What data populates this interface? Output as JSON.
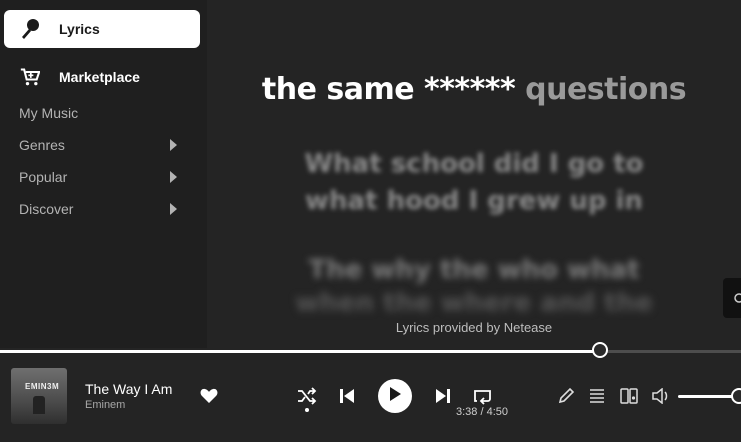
{
  "sidebar": {
    "lyrics_label": "Lyrics",
    "marketplace_label": "Marketplace",
    "items": [
      {
        "label": "My Music",
        "has_arrow": false
      },
      {
        "label": "Genres",
        "has_arrow": true
      },
      {
        "label": "Popular",
        "has_arrow": true
      },
      {
        "label": "Discover",
        "has_arrow": true
      }
    ]
  },
  "lyrics": {
    "current_sung": "the same ******",
    "current_unsung": "questions",
    "next_line_1": "What school did I go to",
    "next_line_2": "what hood I grew up in",
    "following_line_1": "The why the who what",
    "following_line_2": "when the where and the",
    "provider": "Lyrics provided by Netease"
  },
  "player": {
    "track_title": "The Way I Am",
    "artist": "Eminem",
    "album_art_text": "EMIN3M",
    "time_display": "3:38 / 4:50",
    "progress_fraction": 0.81,
    "volume_fraction": 1.0,
    "liked": true,
    "shuffle_on": true,
    "icons": [
      "heart-icon",
      "shuffle-icon",
      "previous-icon",
      "play-icon",
      "next-icon",
      "repeat-icon",
      "pencil-icon",
      "queue-icon",
      "device-icon",
      "volume-icon"
    ]
  },
  "colors": {
    "accent": "#ffffff",
    "background": "#242424",
    "sidebar": "#1f1f1f"
  }
}
